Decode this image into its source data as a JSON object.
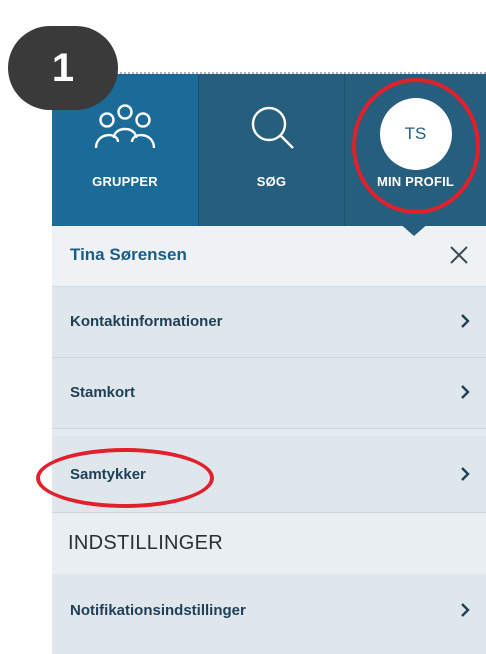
{
  "step": {
    "number": "1"
  },
  "nav": {
    "tabs": [
      {
        "label": "GRUPPER",
        "icon": "group-people-icon"
      },
      {
        "label": "SØG",
        "icon": "search-icon"
      },
      {
        "label": "MIN PROFIL",
        "icon": "avatar",
        "initials": "TS"
      }
    ],
    "colors": {
      "active": "#1a6b98",
      "inactive": "#265e7e"
    }
  },
  "panel": {
    "user_name": "Tina Sørensen",
    "close_icon": "close-icon",
    "items": [
      {
        "label": "Kontaktinformationer",
        "icon": "chevron-right-icon"
      },
      {
        "label": "Stamkort",
        "icon": "chevron-right-icon"
      },
      {
        "label": "Samtykker",
        "icon": "chevron-right-icon"
      }
    ],
    "section_title": "INDSTILLINGER",
    "settings_items": [
      {
        "label": "Notifikationsindstillinger",
        "icon": "chevron-right-icon"
      }
    ]
  },
  "annotations": {
    "highlight_color": "#e2202b"
  }
}
